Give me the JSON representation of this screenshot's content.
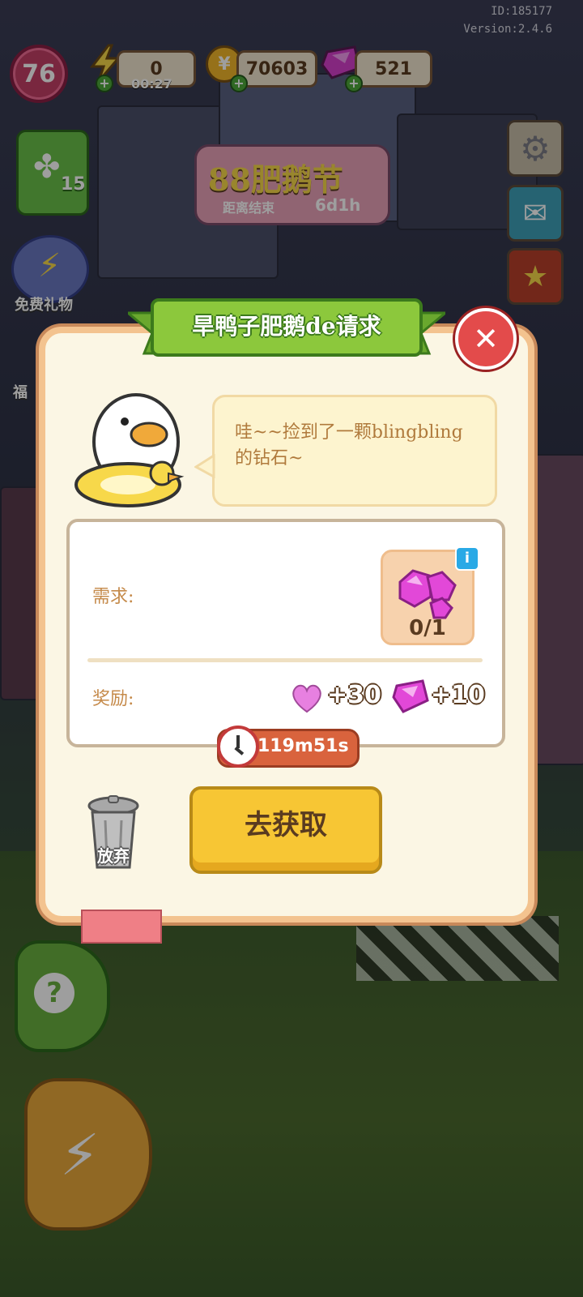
{
  "top_bar": {
    "level": "76",
    "energy_value": "0",
    "energy_timer": "00:27",
    "coins_value": "70603",
    "gems_value": "521"
  },
  "corner": {
    "id_text": "ID:185177",
    "version_text": "Version:2.4.6"
  },
  "left_panel": {
    "clover_count": "15",
    "gift_label": "免费礼物",
    "welfare_label": "福"
  },
  "event_banner": {
    "timer": "6d1h",
    "ends_label": "距离结束"
  },
  "dialog": {
    "title": "旱鸭子肥鹅de请求",
    "speech": "哇~~捡到了一颗blingbling的钻石~",
    "requirement_label": "需求:",
    "requirement_count": "0/1",
    "reward_label": "奖励:",
    "reward_heart": "+30",
    "reward_gem": "+10",
    "timer": "119m51s",
    "go_button": "去获取",
    "abandon_label": "放弃"
  },
  "colors": {
    "dialog_bg": "#fbf6e4",
    "title_green": "#8cc83c",
    "go_button": "#f7c634",
    "close_red": "#e34b4b",
    "gem_pink": "#e248d8"
  }
}
